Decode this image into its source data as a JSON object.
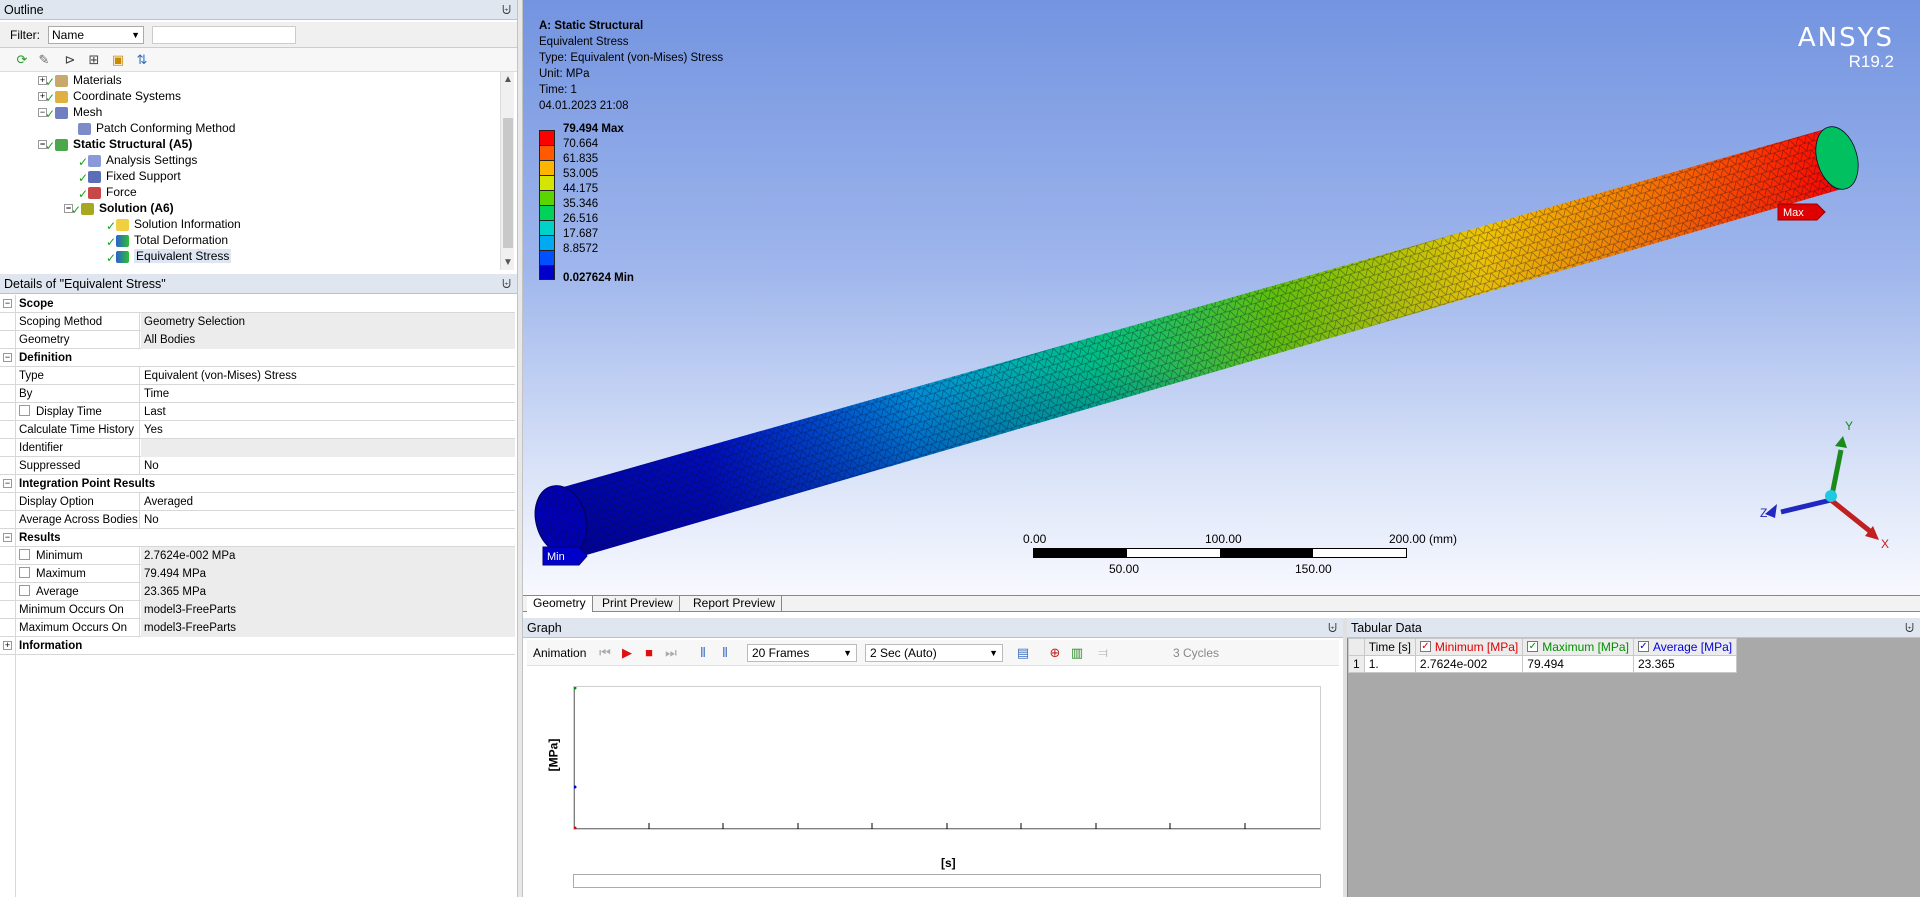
{
  "outline": {
    "title": "Outline",
    "pin": "⨄",
    "filter_label": "Filter:",
    "filter_value": "Name",
    "tree": [
      {
        "label": "Materials",
        "bold": false
      },
      {
        "label": "Coordinate Systems",
        "bold": false
      },
      {
        "label": "Mesh",
        "bold": false
      },
      {
        "label": "Patch Conforming Method",
        "bold": false
      },
      {
        "label": "Static Structural (A5)",
        "bold": true
      },
      {
        "label": "Analysis Settings",
        "bold": false
      },
      {
        "label": "Fixed Support",
        "bold": false
      },
      {
        "label": "Force",
        "bold": false
      },
      {
        "label": "Solution (A6)",
        "bold": true
      },
      {
        "label": "Solution Information",
        "bold": false
      },
      {
        "label": "Total Deformation",
        "bold": false
      },
      {
        "label": "Equivalent Stress",
        "bold": false
      }
    ]
  },
  "details": {
    "title": "Details of \"Equivalent Stress\"",
    "rows": [
      {
        "kind": "section",
        "label": "Scope",
        "exp": "−"
      },
      {
        "kind": "row",
        "key": "Scoping Method",
        "value": "Geometry Selection",
        "grey": true,
        "cb": false
      },
      {
        "kind": "row",
        "key": "Geometry",
        "value": "All Bodies",
        "grey": true,
        "cb": false
      },
      {
        "kind": "section",
        "label": "Definition",
        "exp": "−"
      },
      {
        "kind": "row",
        "key": "Type",
        "value": "Equivalent (von-Mises) Stress",
        "grey": false,
        "cb": false
      },
      {
        "kind": "row",
        "key": "By",
        "value": "Time",
        "grey": false,
        "cb": false
      },
      {
        "kind": "row",
        "key": "Display Time",
        "value": "Last",
        "grey": false,
        "cb": true
      },
      {
        "kind": "row",
        "key": "Calculate Time History",
        "value": "Yes",
        "grey": false,
        "cb": false
      },
      {
        "kind": "row",
        "key": "Identifier",
        "value": "",
        "grey": true,
        "cb": false
      },
      {
        "kind": "row",
        "key": "Suppressed",
        "value": "No",
        "grey": false,
        "cb": false
      },
      {
        "kind": "section",
        "label": "Integration Point Results",
        "exp": "−"
      },
      {
        "kind": "row",
        "key": "Display Option",
        "value": "Averaged",
        "grey": false,
        "cb": false
      },
      {
        "kind": "row",
        "key": "Average Across Bodies",
        "value": "No",
        "grey": false,
        "cb": false
      },
      {
        "kind": "section",
        "label": "Results",
        "exp": "−"
      },
      {
        "kind": "row",
        "key": "Minimum",
        "value": "2.7624e-002 MPa",
        "grey": true,
        "cb": true
      },
      {
        "kind": "row",
        "key": "Maximum",
        "value": "79.494 MPa",
        "grey": true,
        "cb": true
      },
      {
        "kind": "row",
        "key": "Average",
        "value": "23.365 MPa",
        "grey": true,
        "cb": true
      },
      {
        "kind": "row",
        "key": "Minimum Occurs On",
        "value": "model3-FreeParts",
        "grey": true,
        "cb": false
      },
      {
        "kind": "row",
        "key": "Maximum Occurs On",
        "value": "model3-FreeParts",
        "grey": true,
        "cb": false
      },
      {
        "kind": "section",
        "label": "Information",
        "exp": "+"
      }
    ]
  },
  "viewport": {
    "info": [
      "A: Static Structural",
      "Equivalent Stress",
      "Type: Equivalent (von-Mises) Stress",
      "Unit: MPa",
      "Time: 1",
      "04.01.2023 21:08"
    ],
    "brand": "ANSYS",
    "version": "R19.2",
    "legend": [
      {
        "label": "79.494 Max",
        "color": "#ff0000",
        "bold": true
      },
      {
        "label": "70.664",
        "color": "#ff5a00",
        "bold": false
      },
      {
        "label": "61.835",
        "color": "#ffb400",
        "bold": false
      },
      {
        "label": "53.005",
        "color": "#d4e600",
        "bold": false
      },
      {
        "label": "44.175",
        "color": "#5ad500",
        "bold": false
      },
      {
        "label": "35.346",
        "color": "#00d25a",
        "bold": false
      },
      {
        "label": "26.516",
        "color": "#00d2c8",
        "bold": false
      },
      {
        "label": "17.687",
        "color": "#00aaf0",
        "bold": false
      },
      {
        "label": "8.8572",
        "color": "#0050ff",
        "bold": false
      },
      {
        "label": "0.027624 Min",
        "color": "#0000c8",
        "bold": true
      }
    ],
    "max_label": "Max",
    "min_label": "Min",
    "triad": {
      "x": "X",
      "y": "Y",
      "z": "Z"
    },
    "scalebar": {
      "top_labels": [
        "0.00",
        "100.00",
        "200.00 (mm)"
      ],
      "bottom_labels": [
        "50.00",
        "150.00"
      ]
    },
    "tabs": [
      "Geometry",
      "Print Preview",
      "Report Preview"
    ]
  },
  "graph": {
    "title": "Graph",
    "animation_label": "Animation",
    "frames": "20 Frames",
    "duration": "2 Sec (Auto)",
    "cycles": "3 Cycles",
    "ylabel": "[MPa]",
    "xlabel": "[s]"
  },
  "tabular": {
    "title": "Tabular Data",
    "headers": [
      "Time [s]",
      "Minimum [MPa]",
      "Maximum [MPa]",
      "Average [MPa]"
    ],
    "header_colors": [
      "#000000",
      "#e00000",
      "#009000",
      "#0000e0"
    ],
    "rows": [
      {
        "n": "1",
        "cells": [
          "1.",
          "2.7624e-002",
          "79.494",
          "23.365"
        ]
      }
    ]
  }
}
